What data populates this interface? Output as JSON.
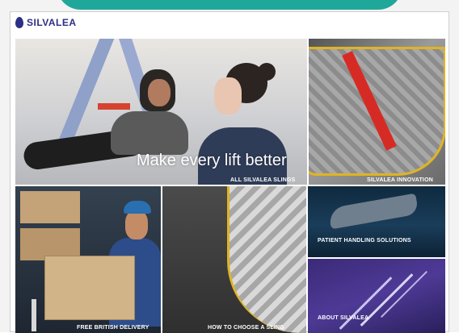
{
  "brand": {
    "name": "SILVALEA",
    "accent": "#2c2f86",
    "top_accent": "#1fa89a"
  },
  "tiles": {
    "hero": {
      "headline": "Make every lift better",
      "cta": "ALL SILVALEA SLINGS"
    },
    "innovation": {
      "cta": "SILVALEA INNOVATION"
    },
    "delivery": {
      "cta": "FREE BRITISH DELIVERY"
    },
    "choose_sling": {
      "cta": "HOW TO CHOOSE A SLING"
    },
    "patient_handling": {
      "cta": "PATIENT HANDLING SOLUTIONS"
    },
    "about": {
      "cta": "ABOUT SILVALEA"
    }
  },
  "colors": {
    "sling_yellow": "#e0b422",
    "sling_red": "#d62b24",
    "about_purple": "#4e3a96",
    "patient_navy": "#1a3d5a"
  }
}
